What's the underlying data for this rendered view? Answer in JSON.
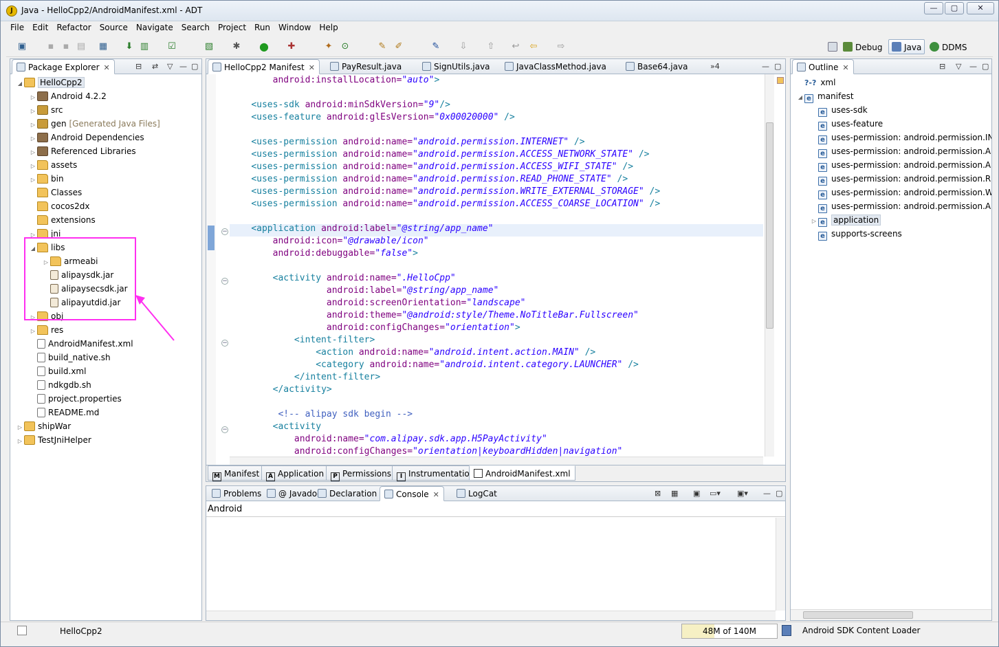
{
  "window": {
    "title": "Java - HelloCpp2/AndroidManifest.xml - ADT",
    "controls": {
      "minimize": "—",
      "maximize": "▢",
      "close": "✕"
    }
  },
  "menu": [
    "File",
    "Edit",
    "Refactor",
    "Source",
    "Navigate",
    "Search",
    "Project",
    "Run",
    "Window",
    "Help"
  ],
  "perspectives": [
    {
      "label": "Debug",
      "active": false
    },
    {
      "label": "Java",
      "active": true
    },
    {
      "label": "DDMS",
      "active": false
    }
  ],
  "package_explorer": {
    "title": "Package Explorer",
    "tree": [
      {
        "label": "HelloCpp2",
        "icon": "project-icon",
        "level": 0,
        "expanded": true,
        "selected": true
      },
      {
        "label": "Android 4.2.2",
        "icon": "library-icon",
        "level": 1,
        "expandable": true
      },
      {
        "label": "src",
        "icon": "package-folder-icon",
        "level": 1,
        "expandable": true
      },
      {
        "label": "gen",
        "suffix": "[Generated Java Files]",
        "icon": "package-folder-icon",
        "level": 1,
        "expandable": true
      },
      {
        "label": "Android Dependencies",
        "icon": "library-icon",
        "level": 1,
        "expandable": true
      },
      {
        "label": "Referenced Libraries",
        "icon": "library-icon",
        "level": 1,
        "expandable": true
      },
      {
        "label": "assets",
        "icon": "folder-icon",
        "level": 1,
        "expandable": true
      },
      {
        "label": "bin",
        "icon": "folder-icon",
        "level": 1,
        "expandable": true
      },
      {
        "label": "Classes",
        "icon": "folder-icon",
        "level": 1
      },
      {
        "label": "cocos2dx",
        "icon": "folder-icon",
        "level": 1
      },
      {
        "label": "extensions",
        "icon": "folder-icon",
        "level": 1
      },
      {
        "label": "jni",
        "icon": "folder-icon",
        "level": 1,
        "expandable": true
      },
      {
        "label": "libs",
        "icon": "folder-icon",
        "level": 1,
        "expanded": true
      },
      {
        "label": "armeabi",
        "icon": "folder-icon",
        "level": 2,
        "expandable": true
      },
      {
        "label": "alipaysdk.jar",
        "icon": "jar-icon",
        "level": 2
      },
      {
        "label": "alipaysecsdk.jar",
        "icon": "jar-icon",
        "level": 2
      },
      {
        "label": "alipayutdid.jar",
        "icon": "jar-icon",
        "level": 2
      },
      {
        "label": "obj",
        "icon": "folder-icon",
        "level": 1,
        "expandable": true
      },
      {
        "label": "res",
        "icon": "folder-icon",
        "level": 1,
        "expandable": true
      },
      {
        "label": "AndroidManifest.xml",
        "icon": "file-icon",
        "level": 1
      },
      {
        "label": "build_native.sh",
        "icon": "file-icon",
        "level": 1
      },
      {
        "label": "build.xml",
        "icon": "file-icon",
        "level": 1
      },
      {
        "label": "ndkgdb.sh",
        "icon": "file-icon",
        "level": 1
      },
      {
        "label": "project.properties",
        "icon": "file-icon",
        "level": 1
      },
      {
        "label": "README.md",
        "icon": "file-icon",
        "level": 1
      },
      {
        "label": "shipWar",
        "icon": "project-icon",
        "level": 0,
        "expandable": true
      },
      {
        "label": "TestJniHelper",
        "icon": "project-icon",
        "level": 0,
        "expandable": true
      }
    ]
  },
  "editor": {
    "tabs": [
      {
        "label": "HelloCpp2 Manifest",
        "active": true
      },
      {
        "label": "PayResult.java"
      },
      {
        "label": "SignUtils.java"
      },
      {
        "label": "JavaClassMethod.java"
      },
      {
        "label": "Base64.java"
      }
    ],
    "overflow": "»4",
    "lines": [
      [
        {
          "c": "",
          "t": "        "
        },
        {
          "c": "a",
          "t": "android:installLocation="
        },
        {
          "c": "v",
          "t": "\"auto\""
        },
        {
          "c": "t",
          "t": ">"
        }
      ],
      [],
      [
        {
          "c": "",
          "t": "    "
        },
        {
          "c": "t",
          "t": "<uses-sdk "
        },
        {
          "c": "a",
          "t": "android:minSdkVersion="
        },
        {
          "c": "v",
          "t": "\"9\""
        },
        {
          "c": "t",
          "t": "/>"
        }
      ],
      [
        {
          "c": "",
          "t": "    "
        },
        {
          "c": "t",
          "t": "<uses-feature "
        },
        {
          "c": "a",
          "t": "android:glEsVersion="
        },
        {
          "c": "v",
          "t": "\"0x00020000\""
        },
        {
          "c": "t",
          "t": " />"
        }
      ],
      [],
      [
        {
          "c": "",
          "t": "    "
        },
        {
          "c": "t",
          "t": "<uses-permission "
        },
        {
          "c": "a",
          "t": "android:name="
        },
        {
          "c": "v",
          "t": "\"android.permission.INTERNET\""
        },
        {
          "c": "t",
          "t": " />"
        }
      ],
      [
        {
          "c": "",
          "t": "    "
        },
        {
          "c": "t",
          "t": "<uses-permission "
        },
        {
          "c": "a",
          "t": "android:name="
        },
        {
          "c": "v",
          "t": "\"android.permission.ACCESS_NETWORK_STATE\""
        },
        {
          "c": "t",
          "t": " />"
        }
      ],
      [
        {
          "c": "",
          "t": "    "
        },
        {
          "c": "t",
          "t": "<uses-permission "
        },
        {
          "c": "a",
          "t": "android:name="
        },
        {
          "c": "v",
          "t": "\"android.permission.ACCESS_WIFI_STATE\""
        },
        {
          "c": "t",
          "t": " />"
        }
      ],
      [
        {
          "c": "",
          "t": "    "
        },
        {
          "c": "t",
          "t": "<uses-permission "
        },
        {
          "c": "a",
          "t": "android:name="
        },
        {
          "c": "v",
          "t": "\"android.permission.READ_PHONE_STATE\""
        },
        {
          "c": "t",
          "t": " />"
        }
      ],
      [
        {
          "c": "",
          "t": "    "
        },
        {
          "c": "t",
          "t": "<uses-permission "
        },
        {
          "c": "a",
          "t": "android:name="
        },
        {
          "c": "v",
          "t": "\"android.permission.WRITE_EXTERNAL_STORAGE\""
        },
        {
          "c": "t",
          "t": " />"
        }
      ],
      [
        {
          "c": "",
          "t": "    "
        },
        {
          "c": "t",
          "t": "<uses-permission "
        },
        {
          "c": "a",
          "t": "android:name="
        },
        {
          "c": "v",
          "t": "\"android.permission.ACCESS_COARSE_LOCATION\""
        },
        {
          "c": "t",
          "t": " />"
        }
      ],
      [],
      [
        {
          "c": "",
          "t": "    "
        },
        {
          "c": "t",
          "t": "<application "
        },
        {
          "c": "a",
          "t": "android:label="
        },
        {
          "c": "v",
          "t": "\"@string/app_name\""
        }
      ],
      [
        {
          "c": "",
          "t": "        "
        },
        {
          "c": "a",
          "t": "android:icon="
        },
        {
          "c": "v",
          "t": "\"@drawable/icon\""
        }
      ],
      [
        {
          "c": "",
          "t": "        "
        },
        {
          "c": "a",
          "t": "android:debuggable="
        },
        {
          "c": "v",
          "t": "\"false\""
        },
        {
          "c": "t",
          "t": ">"
        }
      ],
      [],
      [
        {
          "c": "",
          "t": "        "
        },
        {
          "c": "t",
          "t": "<activity "
        },
        {
          "c": "a",
          "t": "android:name="
        },
        {
          "c": "v",
          "t": "\".HelloCpp\""
        }
      ],
      [
        {
          "c": "",
          "t": "                  "
        },
        {
          "c": "a",
          "t": "android:label="
        },
        {
          "c": "v",
          "t": "\"@string/app_name\""
        }
      ],
      [
        {
          "c": "",
          "t": "                  "
        },
        {
          "c": "a",
          "t": "android:screenOrientation="
        },
        {
          "c": "v",
          "t": "\"landscape\""
        }
      ],
      [
        {
          "c": "",
          "t": "                  "
        },
        {
          "c": "a",
          "t": "android:theme="
        },
        {
          "c": "v",
          "t": "\"@android:style/Theme.NoTitleBar.Fullscreen\""
        }
      ],
      [
        {
          "c": "",
          "t": "                  "
        },
        {
          "c": "a",
          "t": "android:configChanges="
        },
        {
          "c": "v",
          "t": "\"orientation\""
        },
        {
          "c": "t",
          "t": ">"
        }
      ],
      [
        {
          "c": "",
          "t": "            "
        },
        {
          "c": "t",
          "t": "<intent-filter>"
        }
      ],
      [
        {
          "c": "",
          "t": "                "
        },
        {
          "c": "t",
          "t": "<action "
        },
        {
          "c": "a",
          "t": "android:name="
        },
        {
          "c": "v",
          "t": "\"android.intent.action.MAIN\""
        },
        {
          "c": "t",
          "t": " />"
        }
      ],
      [
        {
          "c": "",
          "t": "                "
        },
        {
          "c": "t",
          "t": "<category "
        },
        {
          "c": "a",
          "t": "android:name="
        },
        {
          "c": "v",
          "t": "\"android.intent.category.LAUNCHER\""
        },
        {
          "c": "t",
          "t": " />"
        }
      ],
      [
        {
          "c": "",
          "t": "            "
        },
        {
          "c": "t",
          "t": "</intent-filter>"
        }
      ],
      [
        {
          "c": "",
          "t": "        "
        },
        {
          "c": "t",
          "t": "</activity>"
        }
      ],
      [],
      [
        {
          "c": "",
          "t": "         "
        },
        {
          "c": "c",
          "t": "<!-- alipay sdk begin -->"
        }
      ],
      [
        {
          "c": "",
          "t": "        "
        },
        {
          "c": "t",
          "t": "<activity"
        }
      ],
      [
        {
          "c": "",
          "t": "            "
        },
        {
          "c": "a",
          "t": "android:name="
        },
        {
          "c": "v",
          "t": "\"com.alipay.sdk.app.H5PayActivity\""
        }
      ],
      [
        {
          "c": "",
          "t": "            "
        },
        {
          "c": "a",
          "t": "android:configChanges="
        },
        {
          "c": "v",
          "t": "\"orientation|keyboardHidden|navigation\""
        }
      ]
    ],
    "bottom_tabs": [
      {
        "label": "Manifest",
        "icon": "M"
      },
      {
        "label": "Application",
        "icon": "A"
      },
      {
        "label": "Permissions",
        "icon": "P"
      },
      {
        "label": "Instrumentation",
        "icon": "I"
      },
      {
        "label": "AndroidManifest.xml",
        "icon": "",
        "active": true
      }
    ]
  },
  "console": {
    "tabs": [
      {
        "label": "Problems"
      },
      {
        "label": "Javadoc",
        "prefix": "@"
      },
      {
        "label": "Declaration"
      },
      {
        "label": "Console",
        "active": true
      },
      {
        "label": "LogCat"
      }
    ],
    "header": "Android"
  },
  "outline": {
    "title": "Outline",
    "items": [
      {
        "label": "xml",
        "icon": "?-?",
        "level": 0
      },
      {
        "label": "manifest",
        "icon": "e",
        "level": 0,
        "expanded": true
      },
      {
        "label": "uses-sdk",
        "icon": "e",
        "level": 1
      },
      {
        "label": "uses-feature",
        "icon": "e",
        "level": 1
      },
      {
        "label": "uses-permission: android.permission.IN",
        "icon": "e",
        "level": 1
      },
      {
        "label": "uses-permission: android.permission.A",
        "icon": "e",
        "level": 1
      },
      {
        "label": "uses-permission: android.permission.A",
        "icon": "e",
        "level": 1
      },
      {
        "label": "uses-permission: android.permission.R",
        "icon": "e",
        "level": 1
      },
      {
        "label": "uses-permission: android.permission.W",
        "icon": "e",
        "level": 1
      },
      {
        "label": "uses-permission: android.permission.A",
        "icon": "e",
        "level": 1
      },
      {
        "label": "application",
        "icon": "e",
        "level": 1,
        "expandable": true,
        "selected": true
      },
      {
        "label": "supports-screens",
        "icon": "e",
        "level": 1
      }
    ]
  },
  "status": {
    "selection": "HelloCpp2",
    "heap": "48M of 140M",
    "heap_used_fraction": 0.34,
    "task": "Android SDK Content Loader"
  },
  "annotation_color": "#ff2ff0"
}
